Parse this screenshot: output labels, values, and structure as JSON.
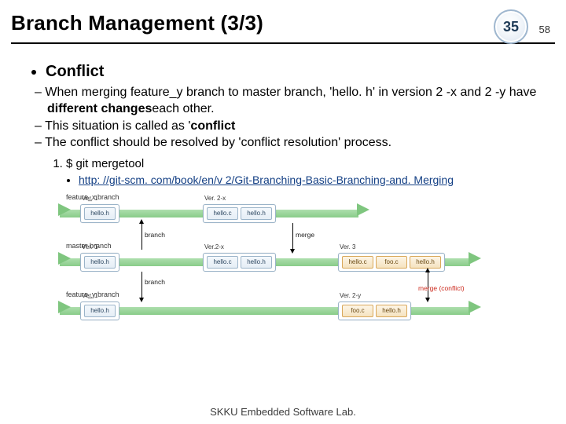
{
  "header": {
    "title": "Branch Management (3/3)",
    "slide_number": "35",
    "total_slides": "58"
  },
  "content": {
    "heading": "Conflict",
    "p1_a": "When merging feature_y branch to master branch, 'hello. h' in version 2 -x and 2 -y have ",
    "p1_b": "different changes",
    "p1_c": "each other.",
    "p2_a": "This situation is called as '",
    "p2_b": "conflict",
    "p3": "The conflict should be resolved by 'conflict resolution' process.",
    "step1": "$ git mergetool",
    "link_text": "http: //git-scm. com/book/en/v 2/Git-Branching-Basic-Branching-and. Merging"
  },
  "diagram": {
    "lane_fx": "feature_x branch",
    "lane_master": "master branch",
    "lane_fy": "feature_y branch",
    "ver1": "Ver. 1",
    "ver2x": "Ver. 2-x",
    "ver2y": "Ver. 2-y",
    "ver2x_again": "Ver.2-x",
    "ver3": "Ver. 3",
    "helloh": "hello.h",
    "helloc": "hello.c",
    "fooc": "foo.c",
    "branch": "branch",
    "merge": "merge",
    "merge_conflict": "merge (conflict)"
  },
  "footer": "SKKU Embedded Software Lab."
}
